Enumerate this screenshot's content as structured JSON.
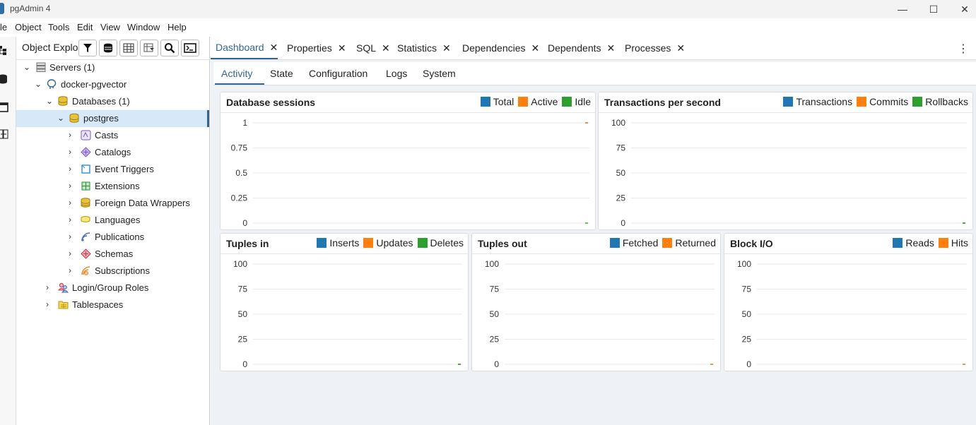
{
  "window": {
    "title": "pgAdmin 4",
    "minimize": "—",
    "maximize": "☐",
    "close": "✕"
  },
  "menu": [
    "le",
    "Object",
    "Tools",
    "Edit",
    "View",
    "Window",
    "Help"
  ],
  "explorer": {
    "title": "Object Explo",
    "tools": [
      "filter-icon",
      "query-tool-icon",
      "table-icon",
      "filtered-rows-icon",
      "search-icon",
      "psql-icon"
    ],
    "tree": [
      {
        "label": "Servers (1)",
        "icon": "servers-icon",
        "expanded": true
      },
      {
        "label": "docker-pgvector",
        "icon": "elephant-icon",
        "expanded": true
      },
      {
        "label": "Databases (1)",
        "icon": "databases-icon",
        "expanded": true
      },
      {
        "label": "postgres",
        "icon": "database-icon",
        "expanded": true,
        "selected": true
      },
      {
        "label": "Casts",
        "icon": "casts-icon"
      },
      {
        "label": "Catalogs",
        "icon": "catalogs-icon"
      },
      {
        "label": "Event Triggers",
        "icon": "event-triggers-icon"
      },
      {
        "label": "Extensions",
        "icon": "extensions-icon"
      },
      {
        "label": "Foreign Data Wrappers",
        "icon": "fdw-icon"
      },
      {
        "label": "Languages",
        "icon": "languages-icon"
      },
      {
        "label": "Publications",
        "icon": "publications-icon"
      },
      {
        "label": "Schemas",
        "icon": "schemas-icon"
      },
      {
        "label": "Subscriptions",
        "icon": "subscriptions-icon"
      },
      {
        "label": "Login/Group Roles",
        "icon": "roles-icon"
      },
      {
        "label": "Tablespaces",
        "icon": "tablespaces-icon"
      }
    ]
  },
  "tabs": [
    {
      "label": "Dashboard",
      "close": "✕"
    },
    {
      "label": "Properties",
      "close": "✕"
    },
    {
      "label": "SQL",
      "close": "✕"
    },
    {
      "label": "Statistics",
      "close": "✕"
    },
    {
      "label": "Dependencies",
      "close": "✕"
    },
    {
      "label": "Dependents",
      "close": "✕"
    },
    {
      "label": "Processes",
      "close": "✕"
    }
  ],
  "more_menu": "⋮",
  "subtabs": [
    "Activity",
    "State",
    "Configuration",
    "Logs",
    "System"
  ],
  "colors": {
    "blue": "#1f77b4",
    "orange": "#ff7f0e",
    "green": "#2ca02c",
    "accent": "#326690"
  },
  "chart_data": [
    {
      "type": "line",
      "title": "Database sessions",
      "ylim": [
        0,
        1
      ],
      "yticks": [
        "0",
        "0.25",
        "0.5",
        "0.75",
        "1"
      ],
      "series": [
        {
          "name": "Total",
          "values": [
            1
          ]
        },
        {
          "name": "Active",
          "values": [
            1
          ]
        },
        {
          "name": "Idle",
          "values": [
            0
          ]
        }
      ]
    },
    {
      "type": "line",
      "title": "Transactions per second",
      "ylim": [
        0,
        100
      ],
      "yticks": [
        "0",
        "25",
        "50",
        "75",
        "100"
      ],
      "series": [
        {
          "name": "Transactions",
          "values": [
            0
          ]
        },
        {
          "name": "Commits",
          "values": [
            0
          ]
        },
        {
          "name": "Rollbacks",
          "values": [
            0
          ]
        }
      ]
    },
    {
      "type": "line",
      "title": "Tuples in",
      "ylim": [
        0,
        100
      ],
      "yticks": [
        "0",
        "25",
        "50",
        "75",
        "100"
      ],
      "series": [
        {
          "name": "Inserts",
          "values": [
            0
          ]
        },
        {
          "name": "Updates",
          "values": [
            0
          ]
        },
        {
          "name": "Deletes",
          "values": [
            0
          ]
        }
      ]
    },
    {
      "type": "line",
      "title": "Tuples out",
      "ylim": [
        0,
        100
      ],
      "yticks": [
        "0",
        "25",
        "50",
        "75",
        "100"
      ],
      "series": [
        {
          "name": "Fetched",
          "values": [
            0
          ]
        },
        {
          "name": "Returned",
          "values": [
            0
          ]
        }
      ]
    },
    {
      "type": "line",
      "title": "Block I/O",
      "ylim": [
        0,
        100
      ],
      "yticks": [
        "0",
        "25",
        "50",
        "75",
        "100"
      ],
      "series": [
        {
          "name": "Reads",
          "values": [
            0
          ]
        },
        {
          "name": "Hits",
          "values": [
            0
          ]
        }
      ]
    }
  ]
}
